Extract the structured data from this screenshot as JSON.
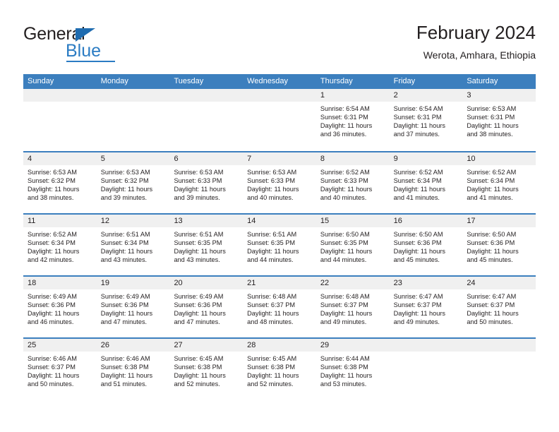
{
  "brand": {
    "name_part1": "General",
    "name_part2": "Blue",
    "triangle_color": "#1f6cb0",
    "blue_color": "#2b7cc3"
  },
  "header": {
    "title": "February 2024",
    "subtitle": "Werota, Amhara, Ethiopia"
  },
  "theme": {
    "header_row_bg": "#3c7fbe",
    "header_row_text": "#ffffff",
    "daynum_bg": "#f0f0f0",
    "row_separator": "#3c7fbe",
    "text": "#231f20"
  },
  "calendar": {
    "weekday_headers": [
      "Sunday",
      "Monday",
      "Tuesday",
      "Wednesday",
      "Thursday",
      "Friday",
      "Saturday"
    ],
    "weeks": [
      [
        {
          "day": "",
          "lines": []
        },
        {
          "day": "",
          "lines": []
        },
        {
          "day": "",
          "lines": []
        },
        {
          "day": "",
          "lines": []
        },
        {
          "day": "1",
          "lines": [
            "Sunrise: 6:54 AM",
            "Sunset: 6:31 PM",
            "Daylight: 11 hours",
            "and 36 minutes."
          ]
        },
        {
          "day": "2",
          "lines": [
            "Sunrise: 6:54 AM",
            "Sunset: 6:31 PM",
            "Daylight: 11 hours",
            "and 37 minutes."
          ]
        },
        {
          "day": "3",
          "lines": [
            "Sunrise: 6:53 AM",
            "Sunset: 6:31 PM",
            "Daylight: 11 hours",
            "and 38 minutes."
          ]
        }
      ],
      [
        {
          "day": "4",
          "lines": [
            "Sunrise: 6:53 AM",
            "Sunset: 6:32 PM",
            "Daylight: 11 hours",
            "and 38 minutes."
          ]
        },
        {
          "day": "5",
          "lines": [
            "Sunrise: 6:53 AM",
            "Sunset: 6:32 PM",
            "Daylight: 11 hours",
            "and 39 minutes."
          ]
        },
        {
          "day": "6",
          "lines": [
            "Sunrise: 6:53 AM",
            "Sunset: 6:33 PM",
            "Daylight: 11 hours",
            "and 39 minutes."
          ]
        },
        {
          "day": "7",
          "lines": [
            "Sunrise: 6:53 AM",
            "Sunset: 6:33 PM",
            "Daylight: 11 hours",
            "and 40 minutes."
          ]
        },
        {
          "day": "8",
          "lines": [
            "Sunrise: 6:52 AM",
            "Sunset: 6:33 PM",
            "Daylight: 11 hours",
            "and 40 minutes."
          ]
        },
        {
          "day": "9",
          "lines": [
            "Sunrise: 6:52 AM",
            "Sunset: 6:34 PM",
            "Daylight: 11 hours",
            "and 41 minutes."
          ]
        },
        {
          "day": "10",
          "lines": [
            "Sunrise: 6:52 AM",
            "Sunset: 6:34 PM",
            "Daylight: 11 hours",
            "and 41 minutes."
          ]
        }
      ],
      [
        {
          "day": "11",
          "lines": [
            "Sunrise: 6:52 AM",
            "Sunset: 6:34 PM",
            "Daylight: 11 hours",
            "and 42 minutes."
          ]
        },
        {
          "day": "12",
          "lines": [
            "Sunrise: 6:51 AM",
            "Sunset: 6:34 PM",
            "Daylight: 11 hours",
            "and 43 minutes."
          ]
        },
        {
          "day": "13",
          "lines": [
            "Sunrise: 6:51 AM",
            "Sunset: 6:35 PM",
            "Daylight: 11 hours",
            "and 43 minutes."
          ]
        },
        {
          "day": "14",
          "lines": [
            "Sunrise: 6:51 AM",
            "Sunset: 6:35 PM",
            "Daylight: 11 hours",
            "and 44 minutes."
          ]
        },
        {
          "day": "15",
          "lines": [
            "Sunrise: 6:50 AM",
            "Sunset: 6:35 PM",
            "Daylight: 11 hours",
            "and 44 minutes."
          ]
        },
        {
          "day": "16",
          "lines": [
            "Sunrise: 6:50 AM",
            "Sunset: 6:36 PM",
            "Daylight: 11 hours",
            "and 45 minutes."
          ]
        },
        {
          "day": "17",
          "lines": [
            "Sunrise: 6:50 AM",
            "Sunset: 6:36 PM",
            "Daylight: 11 hours",
            "and 45 minutes."
          ]
        }
      ],
      [
        {
          "day": "18",
          "lines": [
            "Sunrise: 6:49 AM",
            "Sunset: 6:36 PM",
            "Daylight: 11 hours",
            "and 46 minutes."
          ]
        },
        {
          "day": "19",
          "lines": [
            "Sunrise: 6:49 AM",
            "Sunset: 6:36 PM",
            "Daylight: 11 hours",
            "and 47 minutes."
          ]
        },
        {
          "day": "20",
          "lines": [
            "Sunrise: 6:49 AM",
            "Sunset: 6:36 PM",
            "Daylight: 11 hours",
            "and 47 minutes."
          ]
        },
        {
          "day": "21",
          "lines": [
            "Sunrise: 6:48 AM",
            "Sunset: 6:37 PM",
            "Daylight: 11 hours",
            "and 48 minutes."
          ]
        },
        {
          "day": "22",
          "lines": [
            "Sunrise: 6:48 AM",
            "Sunset: 6:37 PM",
            "Daylight: 11 hours",
            "and 49 minutes."
          ]
        },
        {
          "day": "23",
          "lines": [
            "Sunrise: 6:47 AM",
            "Sunset: 6:37 PM",
            "Daylight: 11 hours",
            "and 49 minutes."
          ]
        },
        {
          "day": "24",
          "lines": [
            "Sunrise: 6:47 AM",
            "Sunset: 6:37 PM",
            "Daylight: 11 hours",
            "and 50 minutes."
          ]
        }
      ],
      [
        {
          "day": "25",
          "lines": [
            "Sunrise: 6:46 AM",
            "Sunset: 6:37 PM",
            "Daylight: 11 hours",
            "and 50 minutes."
          ]
        },
        {
          "day": "26",
          "lines": [
            "Sunrise: 6:46 AM",
            "Sunset: 6:38 PM",
            "Daylight: 11 hours",
            "and 51 minutes."
          ]
        },
        {
          "day": "27",
          "lines": [
            "Sunrise: 6:45 AM",
            "Sunset: 6:38 PM",
            "Daylight: 11 hours",
            "and 52 minutes."
          ]
        },
        {
          "day": "28",
          "lines": [
            "Sunrise: 6:45 AM",
            "Sunset: 6:38 PM",
            "Daylight: 11 hours",
            "and 52 minutes."
          ]
        },
        {
          "day": "29",
          "lines": [
            "Sunrise: 6:44 AM",
            "Sunset: 6:38 PM",
            "Daylight: 11 hours",
            "and 53 minutes."
          ]
        },
        {
          "day": "",
          "lines": []
        },
        {
          "day": "",
          "lines": []
        }
      ]
    ]
  }
}
